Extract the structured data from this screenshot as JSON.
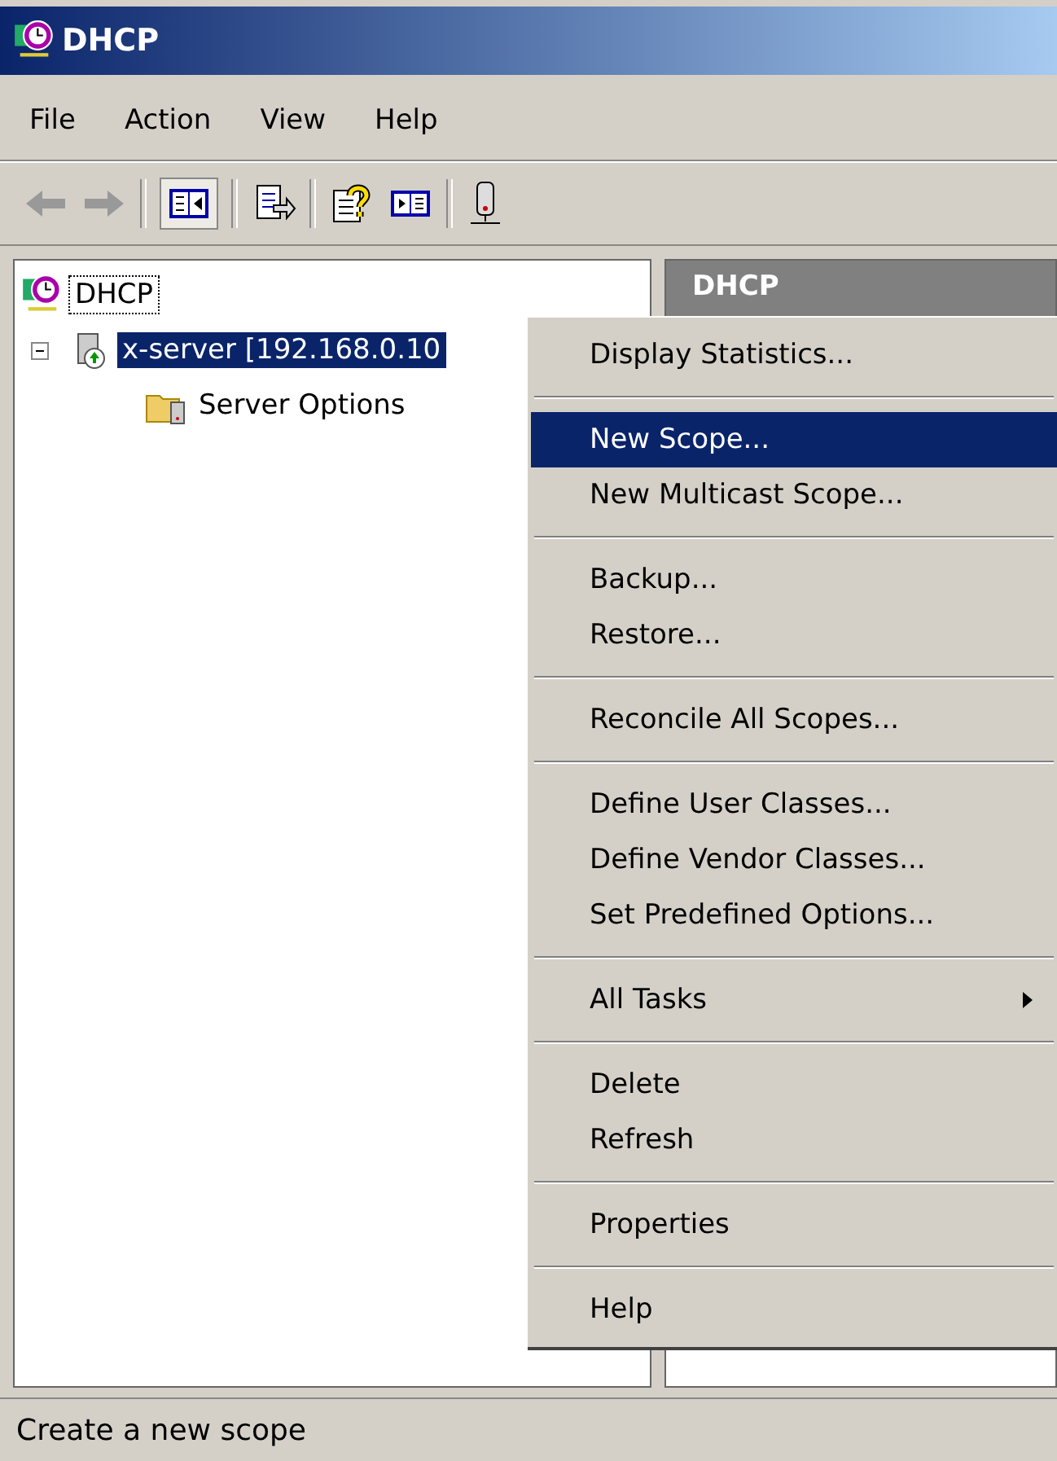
{
  "window": {
    "title": "DHCP"
  },
  "menu_bar": [
    "File",
    "Action",
    "View",
    "Help"
  ],
  "tree": [
    {
      "label": "DHCP",
      "focused": true,
      "selected": false,
      "kind": "root"
    },
    {
      "label": "x-server [192.168.0.10",
      "focused": false,
      "selected": true,
      "expanded": true,
      "kind": "server",
      "children": [
        {
          "label": "Server Options",
          "focused": false,
          "selected": false,
          "kind": "folder"
        }
      ]
    }
  ],
  "right_pane": {
    "header": "DHCP"
  },
  "context_menu": [
    [
      {
        "label": "Display Statistics...",
        "selected": false
      }
    ],
    [
      {
        "label": "New Scope...",
        "selected": true
      },
      {
        "label": "New Multicast Scope...",
        "selected": false
      }
    ],
    [
      {
        "label": "Backup...",
        "selected": false
      },
      {
        "label": "Restore...",
        "selected": false
      }
    ],
    [
      {
        "label": "Reconcile All Scopes...",
        "selected": false
      }
    ],
    [
      {
        "label": "Define User Classes...",
        "selected": false
      },
      {
        "label": "Define Vendor Classes...",
        "selected": false
      },
      {
        "label": "Set Predefined Options...",
        "selected": false
      }
    ],
    [
      {
        "label": "All Tasks",
        "selected": false,
        "submenu": true
      }
    ],
    [
      {
        "label": "Delete",
        "selected": false
      },
      {
        "label": "Refresh",
        "selected": false
      }
    ],
    [
      {
        "label": "Properties",
        "selected": false
      }
    ],
    [
      {
        "label": "Help",
        "selected": false
      }
    ]
  ],
  "status_bar": "Create a new scope"
}
